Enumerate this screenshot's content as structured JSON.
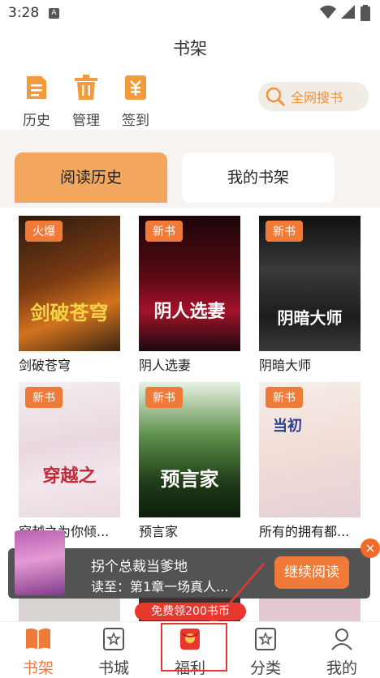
{
  "status": {
    "time": "3:28",
    "sim_label": "A"
  },
  "header": {
    "title": "书架"
  },
  "toolbar": {
    "history": "历史",
    "manage": "管理",
    "checkin": "签到",
    "search_label": "全网搜书"
  },
  "tabs": {
    "history": "阅读历史",
    "shelf": "我的书架"
  },
  "books": [
    {
      "title": "剑破苍穹",
      "badge": "火爆",
      "cover_text": "剑破苍穹"
    },
    {
      "title": "阴人选妻",
      "badge": "新书",
      "cover_text": "阴人选妻"
    },
    {
      "title": "阴暗大师",
      "badge": "新书",
      "cover_text": "阴暗大师"
    },
    {
      "title": "穿越之为你倾...",
      "badge": "新书",
      "cover_text": "穿越之"
    },
    {
      "title": "预言家",
      "badge": "新书",
      "cover_text": "预言家"
    },
    {
      "title": "所有的拥有都...",
      "badge": "新书",
      "cover_text": "当初"
    }
  ],
  "continue_reading": {
    "title": "拐个总裁当爹地",
    "progress": "读至：第1章一场真人...",
    "button": "继续阅读",
    "close": "×"
  },
  "bonus": {
    "label": "免费领200书币"
  },
  "nav": {
    "shelf": "书架",
    "store": "书城",
    "welfare": "福利",
    "category": "分类",
    "mine": "我的"
  },
  "colors": {
    "accent": "#f07a37",
    "active_nav": "#f07a37",
    "red": "#e8372c"
  }
}
